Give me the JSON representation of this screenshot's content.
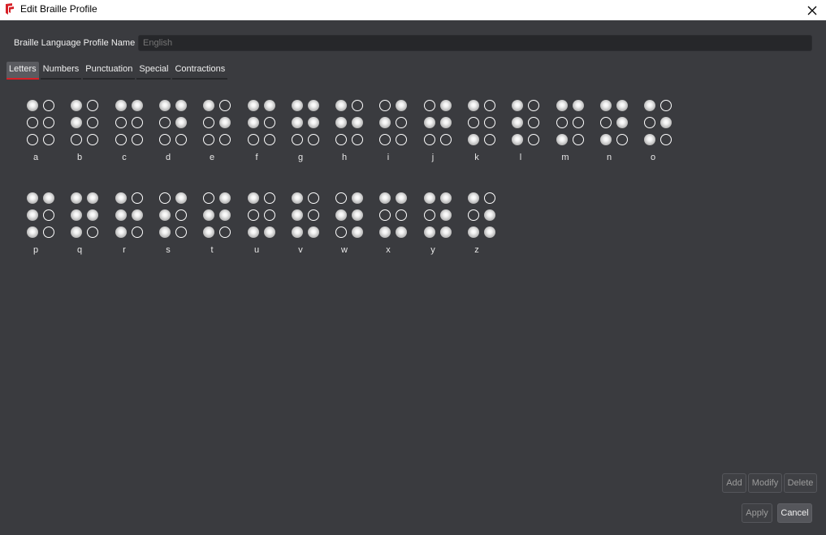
{
  "window": {
    "title": "Edit Braille Profile",
    "app_icon": "brand-logo-icon",
    "close_icon": "close-icon",
    "brand_color": "#d62027"
  },
  "profile": {
    "label": "Braille Language Profile Name",
    "placeholder": "English"
  },
  "tabs": [
    {
      "label": "Letters",
      "active": true
    },
    {
      "label": "Numbers",
      "active": false
    },
    {
      "label": "Punctuation",
      "active": false
    },
    {
      "label": "Special",
      "active": false
    },
    {
      "label": "Contractions",
      "active": false
    }
  ],
  "cells": [
    {
      "label": "a",
      "dots": [
        1,
        0,
        0,
        0,
        0,
        0
      ]
    },
    {
      "label": "b",
      "dots": [
        1,
        1,
        0,
        0,
        0,
        0
      ]
    },
    {
      "label": "c",
      "dots": [
        1,
        0,
        0,
        1,
        0,
        0
      ]
    },
    {
      "label": "d",
      "dots": [
        1,
        0,
        0,
        1,
        1,
        0
      ]
    },
    {
      "label": "e",
      "dots": [
        1,
        0,
        0,
        0,
        1,
        0
      ]
    },
    {
      "label": "f",
      "dots": [
        1,
        1,
        0,
        1,
        0,
        0
      ]
    },
    {
      "label": "g",
      "dots": [
        1,
        1,
        0,
        1,
        1,
        0
      ]
    },
    {
      "label": "h",
      "dots": [
        1,
        1,
        0,
        0,
        1,
        0
      ]
    },
    {
      "label": "i",
      "dots": [
        0,
        1,
        0,
        1,
        0,
        0
      ]
    },
    {
      "label": "j",
      "dots": [
        0,
        1,
        0,
        1,
        1,
        0
      ]
    },
    {
      "label": "k",
      "dots": [
        1,
        0,
        1,
        0,
        0,
        0
      ]
    },
    {
      "label": "l",
      "dots": [
        1,
        1,
        1,
        0,
        0,
        0
      ]
    },
    {
      "label": "m",
      "dots": [
        1,
        0,
        1,
        1,
        0,
        0
      ]
    },
    {
      "label": "n",
      "dots": [
        1,
        0,
        1,
        1,
        1,
        0
      ]
    },
    {
      "label": "o",
      "dots": [
        1,
        0,
        1,
        0,
        1,
        0
      ]
    },
    {
      "label": "p",
      "dots": [
        1,
        1,
        1,
        1,
        0,
        0
      ]
    },
    {
      "label": "q",
      "dots": [
        1,
        1,
        1,
        1,
        1,
        0
      ]
    },
    {
      "label": "r",
      "dots": [
        1,
        1,
        1,
        0,
        1,
        0
      ]
    },
    {
      "label": "s",
      "dots": [
        0,
        1,
        1,
        1,
        0,
        0
      ]
    },
    {
      "label": "t",
      "dots": [
        0,
        1,
        1,
        1,
        1,
        0
      ]
    },
    {
      "label": "u",
      "dots": [
        1,
        0,
        1,
        0,
        0,
        1
      ]
    },
    {
      "label": "v",
      "dots": [
        1,
        1,
        1,
        0,
        0,
        1
      ]
    },
    {
      "label": "w",
      "dots": [
        0,
        1,
        0,
        1,
        1,
        1
      ]
    },
    {
      "label": "x",
      "dots": [
        1,
        0,
        1,
        1,
        0,
        1
      ]
    },
    {
      "label": "y",
      "dots": [
        1,
        0,
        1,
        1,
        1,
        1
      ]
    },
    {
      "label": "z",
      "dots": [
        1,
        0,
        1,
        0,
        1,
        1
      ]
    }
  ],
  "actions": {
    "add": "Add",
    "modify": "Modify",
    "delete": "Delete"
  },
  "footer": {
    "apply": "Apply",
    "cancel": "Cancel"
  }
}
